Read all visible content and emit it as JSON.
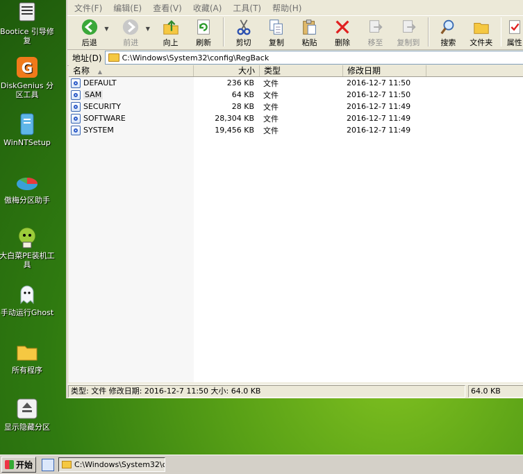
{
  "desktop": {
    "icons": [
      {
        "label": "Bootice 引导修复"
      },
      {
        "label": "DiskGenius 分区工具"
      },
      {
        "label": "WinNTSetup"
      },
      {
        "label": "傲梅分区助手"
      },
      {
        "label": "大白菜PE装机工具"
      },
      {
        "label": "手动运行Ghost"
      },
      {
        "label": "所有程序"
      },
      {
        "label": "显示隐藏分区"
      }
    ]
  },
  "explorer": {
    "menu": [
      "文件(F)",
      "编辑(E)",
      "查看(V)",
      "收藏(A)",
      "工具(T)",
      "帮助(H)"
    ],
    "toolbar": {
      "back": "后退",
      "forward": "前进",
      "up": "向上",
      "refresh": "刷新",
      "cut": "剪切",
      "copy": "复制",
      "paste": "粘贴",
      "delete": "删除",
      "move": "移至",
      "copyto": "复制到",
      "search": "搜索",
      "folders": "文件夹",
      "properties": "属性"
    },
    "address": {
      "label": "地址(D)",
      "value": "C:\\Windows\\System32\\config\\RegBack"
    },
    "columns": {
      "name": "名称",
      "sort_arrow": "▲",
      "size": "大小",
      "type": "类型",
      "modified": "修改日期"
    },
    "files": [
      {
        "name": "DEFAULT",
        "size": "236 KB",
        "type": "文件",
        "modified": "2016-12-7 11:50"
      },
      {
        "name": "SAM",
        "size": "64 KB",
        "type": "文件",
        "modified": "2016-12-7 11:50"
      },
      {
        "name": "SECURITY",
        "size": "28 KB",
        "type": "文件",
        "modified": "2016-12-7 11:49"
      },
      {
        "name": "SOFTWARE",
        "size": "28,304 KB",
        "type": "文件",
        "modified": "2016-12-7 11:49"
      },
      {
        "name": "SYSTEM",
        "size": "19,456 KB",
        "type": "文件",
        "modified": "2016-12-7 11:49"
      }
    ],
    "status": {
      "info": "类型: 文件 修改日期: 2016-12-7 11:50 大小: 64.0 KB",
      "size": "64.0 KB"
    }
  },
  "taskbar": {
    "start": "开始",
    "task": "C:\\Windows\\System32\\c..."
  }
}
